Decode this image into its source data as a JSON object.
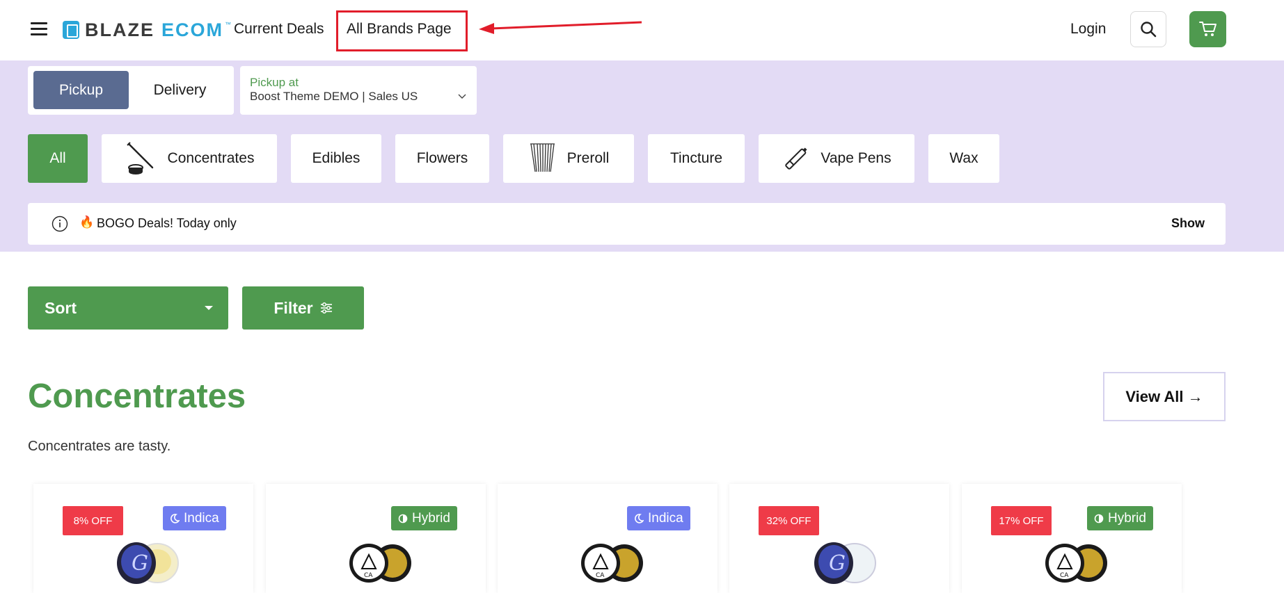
{
  "header": {
    "logo_word1": "BLAZE",
    "logo_word2": "ECOM",
    "logo_tm": "™",
    "nav": {
      "current_deals": "Current Deals",
      "all_brands": "All Brands Page"
    },
    "login": "Login",
    "icons": {
      "menu": "hamburger-icon",
      "search": "search-icon",
      "cart": "cart-icon"
    }
  },
  "fulfillment": {
    "pickup": "Pickup",
    "delivery": "Delivery",
    "pickup_at_label": "Pickup at",
    "pickup_location": "Boost Theme DEMO | Sales US"
  },
  "categories": [
    {
      "label": "All",
      "active": true
    },
    {
      "label": "Concentrates",
      "icon": "concentrates-icon"
    },
    {
      "label": "Edibles"
    },
    {
      "label": "Flowers"
    },
    {
      "label": "Preroll",
      "icon": "preroll-icon"
    },
    {
      "label": "Tincture"
    },
    {
      "label": "Vape Pens",
      "icon": "vape-pen-icon"
    },
    {
      "label": "Wax"
    }
  ],
  "deals_bar": {
    "text": "BOGO Deals! Today only",
    "emoji": "🔥",
    "show": "Show"
  },
  "controls": {
    "sort": "Sort",
    "filter": "Filter"
  },
  "section": {
    "title": "Concentrates",
    "description": "Concentrates are tasty.",
    "view_all": "View All →"
  },
  "products": [
    {
      "discount": "8% OFF",
      "strain": "Indica"
    },
    {
      "discount": "",
      "strain": "Hybrid"
    },
    {
      "discount": "",
      "strain": "Indica"
    },
    {
      "discount": "32% OFF",
      "strain": "",
      "jar": "blue-lid"
    },
    {
      "discount": "17% OFF",
      "strain": "Hybrid"
    }
  ],
  "colors": {
    "green": "#4f9a4f",
    "purple_band": "#e3dbf5",
    "pickup_active": "#5a6b91",
    "indica": "#6f7cf0",
    "sale_red": "#ef3b48",
    "logo_blue": "#2aa6d9",
    "annotation_red": "#e11d2a"
  }
}
